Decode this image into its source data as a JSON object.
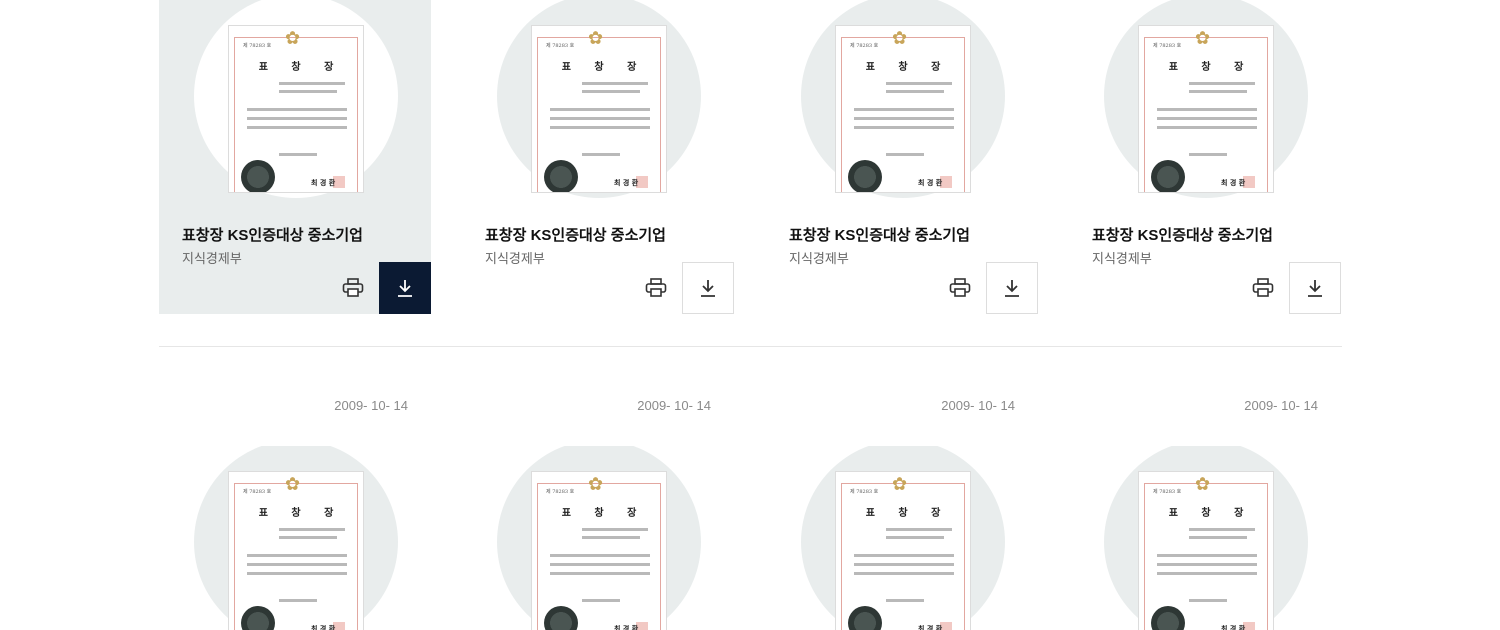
{
  "row1": [
    {
      "title": "표창장 KS인증대상 중소기업",
      "organization": "지식경제부",
      "state": "hover"
    },
    {
      "title": "표창장 KS인증대상 중소기업",
      "organization": "지식경제부",
      "state": "default"
    },
    {
      "title": "표창장 KS인증대상 중소기업",
      "organization": "지식경제부",
      "state": "default"
    },
    {
      "title": "표창장 KS인증대상 중소기업",
      "organization": "지식경제부",
      "state": "default"
    }
  ],
  "row2_dates": [
    "2009- 10- 14",
    "2009- 10- 14",
    "2009- 10- 14",
    "2009- 10- 14"
  ],
  "certificate": {
    "heading": "표 창 장",
    "signer": "최 경 환"
  },
  "icons": {
    "print": "printer-icon",
    "download": "download-icon"
  },
  "colors": {
    "card_hover_bg": "#e9eded",
    "download_active_bg": "#0b1a33",
    "date_text": "#8a8a8a"
  }
}
